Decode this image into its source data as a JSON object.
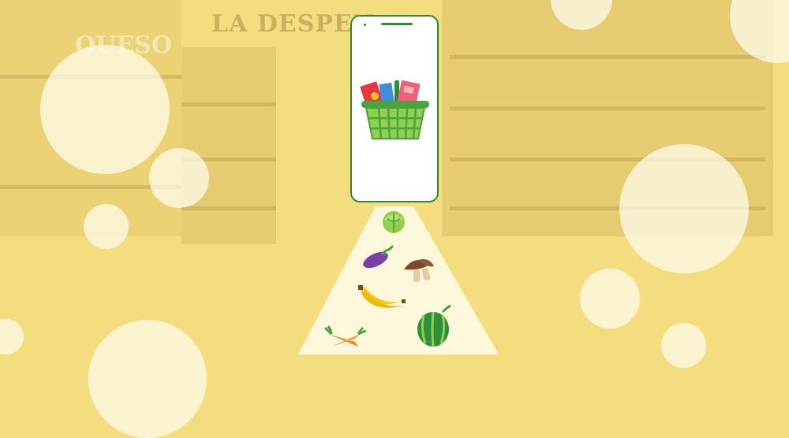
{
  "background": {
    "store_sign": "LA DESPEN",
    "store_sign_2": "QUESO",
    "tint_color": "#f3dd7e"
  },
  "phone": {
    "frame_color": "#2e8b33",
    "screen_icon": "shopping-basket-icon"
  },
  "groceries": [
    {
      "name": "cabbage"
    },
    {
      "name": "eggplant"
    },
    {
      "name": "mushroom"
    },
    {
      "name": "banana"
    },
    {
      "name": "carrot"
    },
    {
      "name": "watermelon"
    }
  ]
}
